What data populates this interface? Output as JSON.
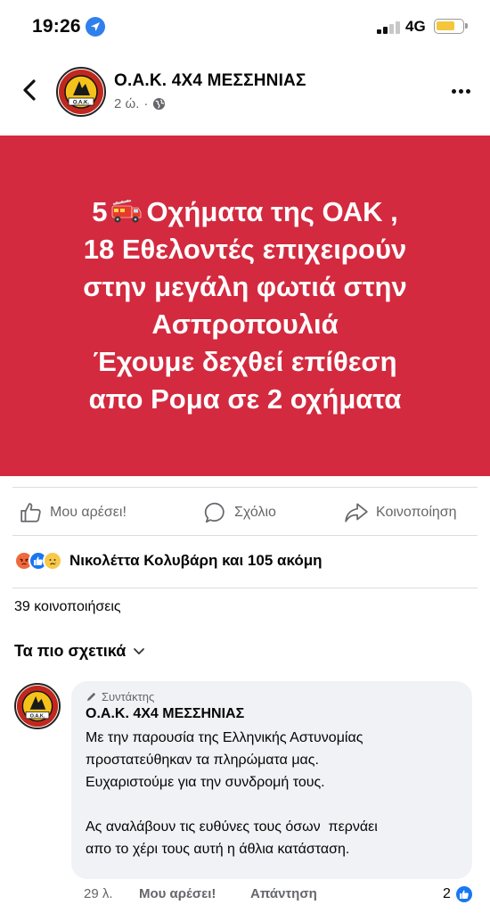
{
  "status_bar": {
    "time": "19:26",
    "network": "4G"
  },
  "post": {
    "page_name": "Ο.Α.Κ. 4Χ4 ΜΕΣΣΗΝΙΑΣ",
    "time": "2 ώ.",
    "separator": "·",
    "avatar_text": "Ο.Α.Κ.",
    "banner_color": "#d32a3f",
    "banner": {
      "line1_pre": "5",
      "line1_icon": "fire-engine-emoji",
      "line1_post": "Οχήματα της ΟΑΚ ,",
      "line2": "18 Εθελοντές επιχειρούν",
      "line3": "στην μεγάλη φωτιά στην",
      "line4": "Ασπροπουλιά",
      "line5": "Έχουμε δεχθεί επίθεση",
      "line6": "απο Ρομα σε 2 οχήματα"
    }
  },
  "actions": {
    "like": "Μου αρέσει!",
    "comment": "Σχόλιο",
    "share": "Κοινοποίηση"
  },
  "reactions": {
    "icons": [
      "angry",
      "like",
      "sad"
    ],
    "text": "Νικολέττα Κολυβάρη και 105 ακόμη"
  },
  "shares": {
    "text": "39 κοινοποιήσεις"
  },
  "sort": {
    "label": "Τα πιο σχετικά"
  },
  "comment": {
    "badge": "Συντάκτης",
    "author": "Ο.Α.Κ. 4Χ4 ΜΕΣΣΗΝΙΑΣ",
    "avatar_text": "Ο.Α.Κ.",
    "paragraph1": [
      "Με την παρουσία της Ελληνικής Αστυνομίας",
      "προστατεύθηκαν τα πληρώματα μας.",
      "Ευχαριστούμε για την συνδρομή τους."
    ],
    "paragraph2": [
      "Ας αναλάβουν τις ευθύνες τους όσων  περνάει",
      "απο το χέρι τους αυτή η άθλια κατάσταση."
    ],
    "time": "29 λ.",
    "like": "Μου αρέσει!",
    "reply": "Απάντηση",
    "reaction_count": "2"
  }
}
